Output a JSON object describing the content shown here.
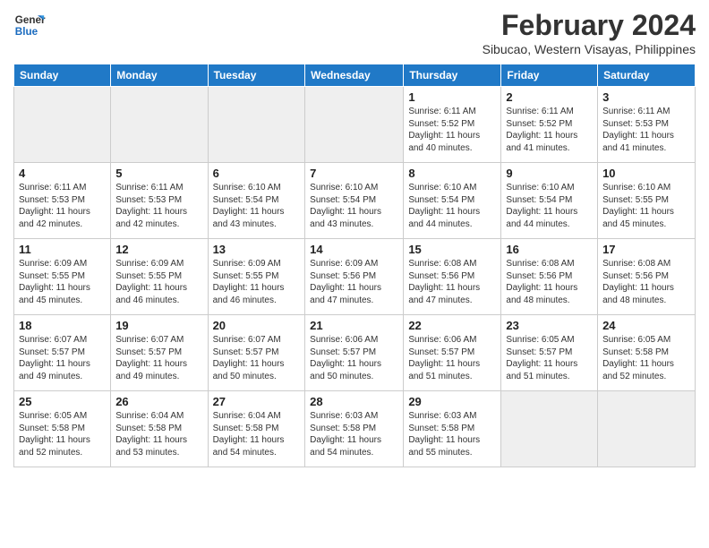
{
  "header": {
    "logo_line1": "General",
    "logo_line2": "Blue",
    "month_year": "February 2024",
    "location": "Sibucao, Western Visayas, Philippines"
  },
  "days_of_week": [
    "Sunday",
    "Monday",
    "Tuesday",
    "Wednesday",
    "Thursday",
    "Friday",
    "Saturday"
  ],
  "weeks": [
    [
      {
        "day": "",
        "empty": true
      },
      {
        "day": "",
        "empty": true
      },
      {
        "day": "",
        "empty": true
      },
      {
        "day": "",
        "empty": true
      },
      {
        "day": "1",
        "sunrise": "6:11 AM",
        "sunset": "5:52 PM",
        "daylight": "11 hours and 40 minutes."
      },
      {
        "day": "2",
        "sunrise": "6:11 AM",
        "sunset": "5:52 PM",
        "daylight": "11 hours and 41 minutes."
      },
      {
        "day": "3",
        "sunrise": "6:11 AM",
        "sunset": "5:53 PM",
        "daylight": "11 hours and 41 minutes."
      }
    ],
    [
      {
        "day": "4",
        "sunrise": "6:11 AM",
        "sunset": "5:53 PM",
        "daylight": "11 hours and 42 minutes."
      },
      {
        "day": "5",
        "sunrise": "6:11 AM",
        "sunset": "5:53 PM",
        "daylight": "11 hours and 42 minutes."
      },
      {
        "day": "6",
        "sunrise": "6:10 AM",
        "sunset": "5:54 PM",
        "daylight": "11 hours and 43 minutes."
      },
      {
        "day": "7",
        "sunrise": "6:10 AM",
        "sunset": "5:54 PM",
        "daylight": "11 hours and 43 minutes."
      },
      {
        "day": "8",
        "sunrise": "6:10 AM",
        "sunset": "5:54 PM",
        "daylight": "11 hours and 44 minutes."
      },
      {
        "day": "9",
        "sunrise": "6:10 AM",
        "sunset": "5:54 PM",
        "daylight": "11 hours and 44 minutes."
      },
      {
        "day": "10",
        "sunrise": "6:10 AM",
        "sunset": "5:55 PM",
        "daylight": "11 hours and 45 minutes."
      }
    ],
    [
      {
        "day": "11",
        "sunrise": "6:09 AM",
        "sunset": "5:55 PM",
        "daylight": "11 hours and 45 minutes."
      },
      {
        "day": "12",
        "sunrise": "6:09 AM",
        "sunset": "5:55 PM",
        "daylight": "11 hours and 46 minutes."
      },
      {
        "day": "13",
        "sunrise": "6:09 AM",
        "sunset": "5:55 PM",
        "daylight": "11 hours and 46 minutes."
      },
      {
        "day": "14",
        "sunrise": "6:09 AM",
        "sunset": "5:56 PM",
        "daylight": "11 hours and 47 minutes."
      },
      {
        "day": "15",
        "sunrise": "6:08 AM",
        "sunset": "5:56 PM",
        "daylight": "11 hours and 47 minutes."
      },
      {
        "day": "16",
        "sunrise": "6:08 AM",
        "sunset": "5:56 PM",
        "daylight": "11 hours and 48 minutes."
      },
      {
        "day": "17",
        "sunrise": "6:08 AM",
        "sunset": "5:56 PM",
        "daylight": "11 hours and 48 minutes."
      }
    ],
    [
      {
        "day": "18",
        "sunrise": "6:07 AM",
        "sunset": "5:57 PM",
        "daylight": "11 hours and 49 minutes."
      },
      {
        "day": "19",
        "sunrise": "6:07 AM",
        "sunset": "5:57 PM",
        "daylight": "11 hours and 49 minutes."
      },
      {
        "day": "20",
        "sunrise": "6:07 AM",
        "sunset": "5:57 PM",
        "daylight": "11 hours and 50 minutes."
      },
      {
        "day": "21",
        "sunrise": "6:06 AM",
        "sunset": "5:57 PM",
        "daylight": "11 hours and 50 minutes."
      },
      {
        "day": "22",
        "sunrise": "6:06 AM",
        "sunset": "5:57 PM",
        "daylight": "11 hours and 51 minutes."
      },
      {
        "day": "23",
        "sunrise": "6:05 AM",
        "sunset": "5:57 PM",
        "daylight": "11 hours and 51 minutes."
      },
      {
        "day": "24",
        "sunrise": "6:05 AM",
        "sunset": "5:58 PM",
        "daylight": "11 hours and 52 minutes."
      }
    ],
    [
      {
        "day": "25",
        "sunrise": "6:05 AM",
        "sunset": "5:58 PM",
        "daylight": "11 hours and 52 minutes."
      },
      {
        "day": "26",
        "sunrise": "6:04 AM",
        "sunset": "5:58 PM",
        "daylight": "11 hours and 53 minutes."
      },
      {
        "day": "27",
        "sunrise": "6:04 AM",
        "sunset": "5:58 PM",
        "daylight": "11 hours and 54 minutes."
      },
      {
        "day": "28",
        "sunrise": "6:03 AM",
        "sunset": "5:58 PM",
        "daylight": "11 hours and 54 minutes."
      },
      {
        "day": "29",
        "sunrise": "6:03 AM",
        "sunset": "5:58 PM",
        "daylight": "11 hours and 55 minutes."
      },
      {
        "day": "",
        "empty": true
      },
      {
        "day": "",
        "empty": true
      }
    ]
  ]
}
